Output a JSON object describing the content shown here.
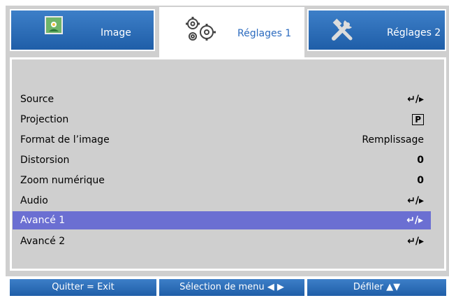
{
  "tabs": [
    {
      "label": "Image",
      "icon": "image-icon"
    },
    {
      "label": "Réglages 1",
      "icon": "gears-icon"
    },
    {
      "label": "Réglages 2",
      "icon": "tools-icon"
    }
  ],
  "menu": {
    "items": [
      {
        "label": "Source",
        "value": "↵/▸"
      },
      {
        "label": "Projection",
        "value": "P"
      },
      {
        "label": "Format de l’image",
        "value": "Remplissage"
      },
      {
        "label": "Distorsion",
        "value": "0"
      },
      {
        "label": "Zoom numérique",
        "value": "0"
      },
      {
        "label": "Audio",
        "value": "↵/▸"
      },
      {
        "label": "Avancé 1",
        "value": "↵/▸"
      },
      {
        "label": "Avancé 2",
        "value": "↵/▸"
      }
    ]
  },
  "footer": {
    "exit": "Quitter = Exit",
    "select": "Sélection de menu ◀ ▶",
    "scroll": "Défiler ▲▼"
  },
  "colors": {
    "tab_blue": "#2c6bbf",
    "selected_row": "#6b6fd2",
    "panel_gray": "#cfcfcf"
  }
}
